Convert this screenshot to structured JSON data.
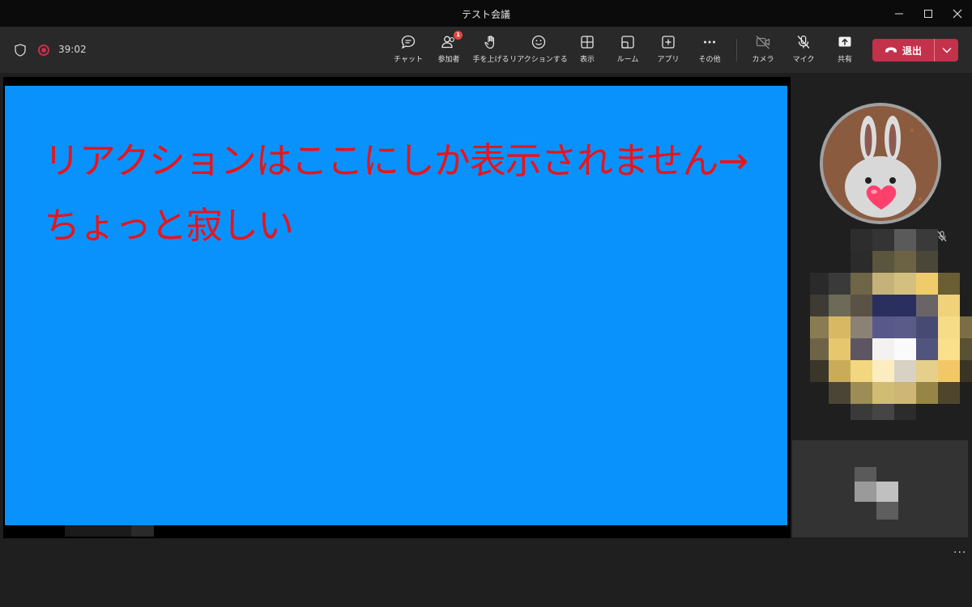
{
  "window": {
    "title": "テスト会議",
    "controls": [
      "minimize-icon",
      "maximize-icon",
      "close-icon"
    ]
  },
  "toolbar": {
    "timer": "39:02",
    "items": [
      {
        "id": "chat",
        "label": "チャット",
        "icon": "chat-icon"
      },
      {
        "id": "participants",
        "label": "参加者",
        "icon": "people-icon",
        "badge": "1"
      },
      {
        "id": "raise-hand",
        "label": "手を上げる",
        "icon": "hand-icon"
      },
      {
        "id": "reactions",
        "label": "リアクションする",
        "icon": "smiley-icon"
      },
      {
        "id": "view",
        "label": "表示",
        "icon": "grid-icon"
      },
      {
        "id": "rooms",
        "label": "ルーム",
        "icon": "rooms-icon"
      },
      {
        "id": "apps",
        "label": "アプリ",
        "icon": "plus-box-icon"
      },
      {
        "id": "more",
        "label": "その他",
        "icon": "ellipsis-icon"
      },
      {
        "id": "camera",
        "label": "カメラ",
        "icon": "camera-off-icon"
      },
      {
        "id": "mic",
        "label": "マイク",
        "icon": "mic-off-icon"
      },
      {
        "id": "share",
        "label": "共有",
        "icon": "share-icon"
      }
    ],
    "leave_label": "退出"
  },
  "stage": {
    "line1": "リアクションはここにしか表示されません→",
    "line2": "ちょっと寂しい"
  },
  "colors": {
    "accent_leave": "#c4314b",
    "share_bg": "#0a92fc",
    "annotation_text": "#e8141b",
    "toolbar_bg": "#292929"
  }
}
